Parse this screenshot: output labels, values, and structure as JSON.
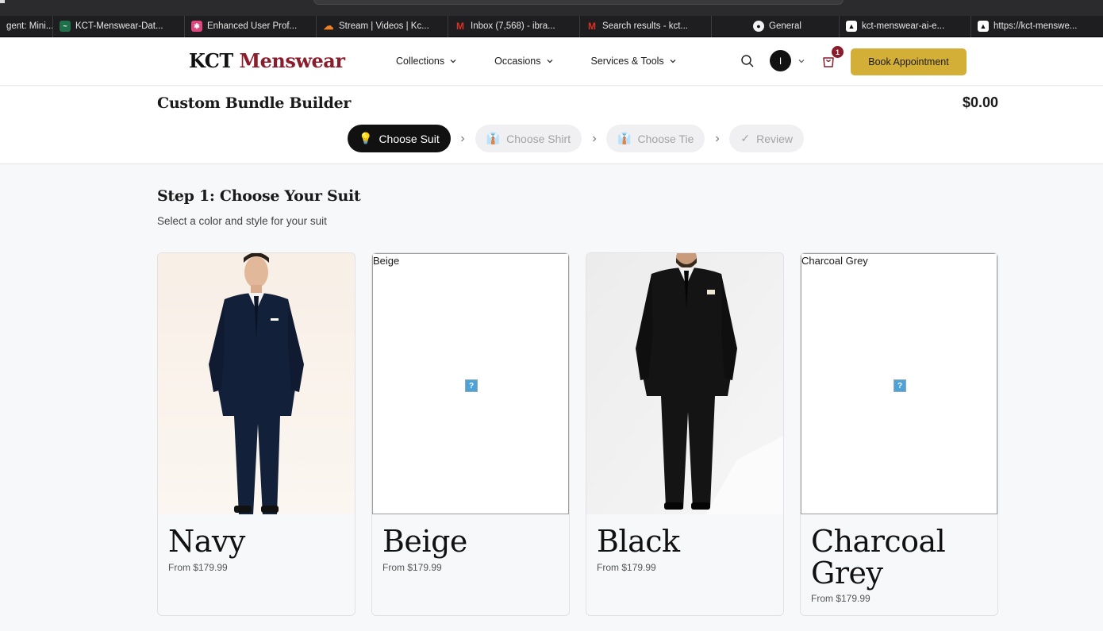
{
  "bookmarks": [
    {
      "label": "gent: Mini...",
      "color": "#555",
      "glyph": ""
    },
    {
      "label": "KCT-Menswear-Dat...",
      "color": "#2a9d6a",
      "glyph": "~"
    },
    {
      "label": "Enhanced User Prof...",
      "color": "#e0457b",
      "glyph": "*"
    },
    {
      "label": "Stream | Videos | Kc...",
      "color": "#f38020",
      "glyph": "c"
    },
    {
      "label": "Inbox (7,568) - ibra...",
      "color": "#d93025",
      "glyph": "M"
    },
    {
      "label": "Search results - kct...",
      "color": "#d93025",
      "glyph": "M"
    },
    {
      "label": "General",
      "color": "#333",
      "glyph": "g"
    },
    {
      "label": "kct-menswear-ai-e...",
      "color": "#111",
      "glyph": "^"
    },
    {
      "label": "https://kct-menswe...",
      "color": "#111",
      "glyph": "^"
    }
  ],
  "header": {
    "logo_kct": "KCT",
    "logo_menswear": "Menswear",
    "nav": [
      "Collections",
      "Occasions",
      "Services & Tools"
    ],
    "avatar_initial": "I",
    "cart_count": "1",
    "book_button": "Book Appointment"
  },
  "builder": {
    "title": "Custom Bundle Builder",
    "total": "$0.00",
    "steps": [
      {
        "icon": "💡",
        "label": "Choose Suit"
      },
      {
        "icon": "👔",
        "label": "Choose Shirt"
      },
      {
        "icon": "👔",
        "label": "Choose Tie"
      },
      {
        "icon": "✓",
        "label": "Review"
      }
    ]
  },
  "main": {
    "heading": "Step 1: Choose Your Suit",
    "subheading": "Select a color and style for your suit",
    "suits": [
      {
        "name": "Navy",
        "price": "From $179.99",
        "image_alt": ""
      },
      {
        "name": "Beige",
        "price": "From $179.99",
        "image_alt": "Beige"
      },
      {
        "name": "Black",
        "price": "From $179.99",
        "image_alt": ""
      },
      {
        "name": "Charcoal Grey",
        "price": "From $179.99",
        "image_alt": "Charcoal Grey"
      }
    ]
  }
}
